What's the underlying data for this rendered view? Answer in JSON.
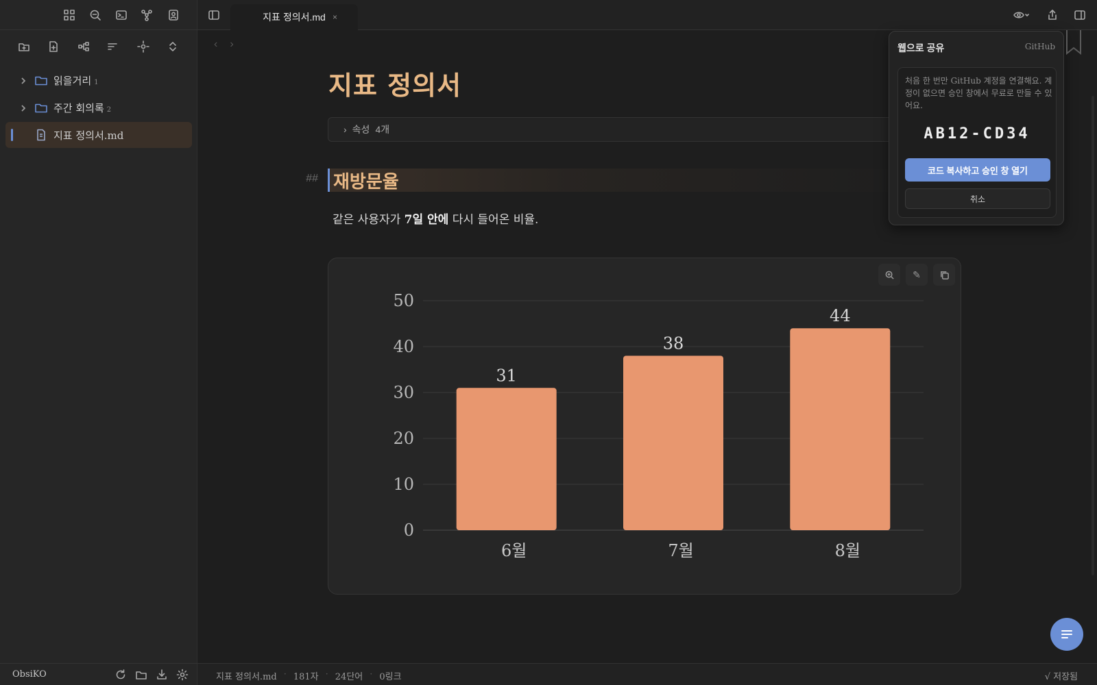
{
  "sidebar": {
    "top_icons": [
      "grid-icon",
      "search-icon",
      "terminal-icon",
      "graph-icon",
      "contacts-icon"
    ],
    "actions": [
      "new-folder-icon",
      "new-note-icon",
      "hierarchy-icon",
      "sort-icon",
      "locate-icon",
      "expand-collapse-icon"
    ],
    "items": [
      {
        "label": "읽을거리",
        "count": "1",
        "type": "folder"
      },
      {
        "label": "주간 회의록",
        "count": "2",
        "type": "folder"
      },
      {
        "label": "지표 정의서.md",
        "count": "",
        "type": "file",
        "active": true
      }
    ],
    "vault_name": "ObsiKO",
    "bottom_icons": [
      "refresh-icon",
      "folder-icon",
      "download-icon",
      "settings-icon"
    ]
  },
  "tab": {
    "title": "지표 정의서.md",
    "close": "×"
  },
  "editor": {
    "title": "지표 정의서",
    "properties_label": "속성",
    "properties_count": "4개",
    "heading_marker": "##",
    "heading": "재방문율",
    "paragraph_prefix": "같은 사용자가 ",
    "paragraph_bold": "7일 안에",
    "paragraph_suffix": " 다시 들어온 비율."
  },
  "chart_data": {
    "type": "bar",
    "categories": [
      "6월",
      "7월",
      "8월"
    ],
    "values": [
      31,
      38,
      44
    ],
    "ylim": [
      0,
      50
    ],
    "yticks": [
      0,
      10,
      20,
      30,
      40,
      50
    ],
    "grid": true,
    "bar_color": "#e8976f",
    "title": "",
    "xlabel": "",
    "ylabel": ""
  },
  "share_popup": {
    "title": "웹으로 공유",
    "provider": "GitHub",
    "description": "처음 한 번만 GitHub 계정을 연결해요. 계정이 없으면 승인 창에서 무료로 만들 수 있어요.",
    "code": "AB12-CD34",
    "primary_button": "코드 복사하고 승인 창 열기",
    "cancel_button": "취소"
  },
  "statusbar": {
    "file": "지표 정의서.md",
    "chars": "181자",
    "words": "24단어",
    "links": "0링크",
    "saved": "√ 저장됨"
  },
  "colors": {
    "accent": "#6b8fd6",
    "heading": "#e9b986",
    "bar": "#e8976f"
  }
}
